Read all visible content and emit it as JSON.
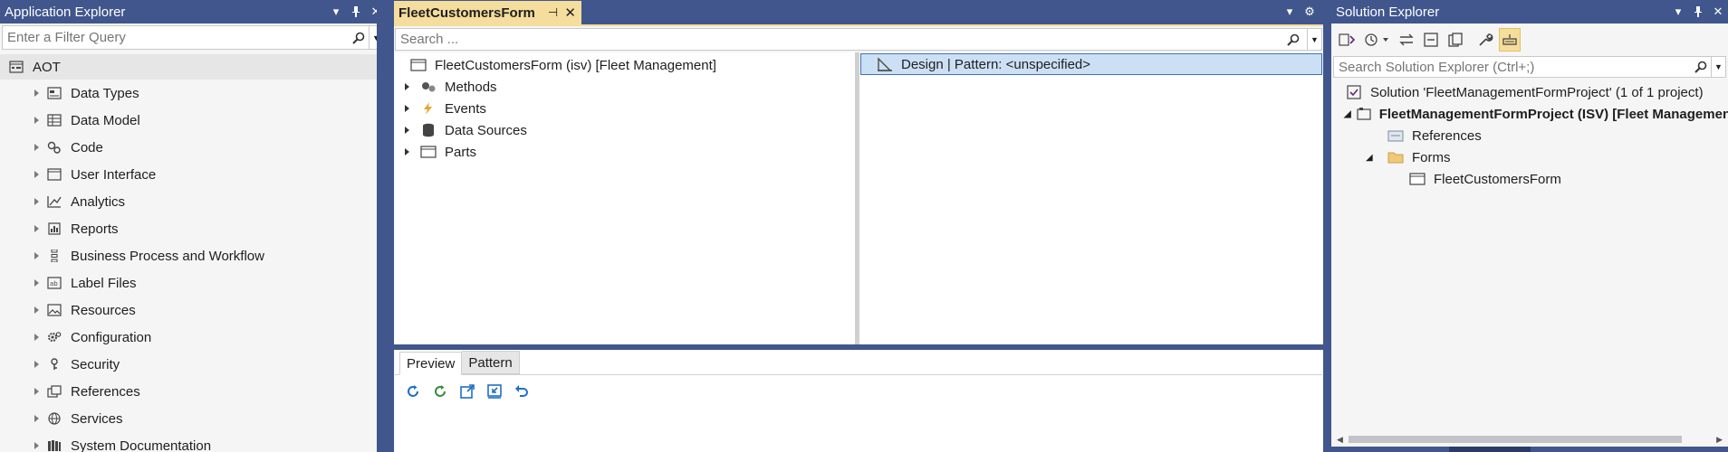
{
  "app_explorer": {
    "title": "Application Explorer",
    "filter_placeholder": "Enter a Filter Query",
    "root": "AOT",
    "items": [
      {
        "label": "Data Types",
        "icon": "data-types-icon"
      },
      {
        "label": "Data Model",
        "icon": "data-model-icon"
      },
      {
        "label": "Code",
        "icon": "code-icon"
      },
      {
        "label": "User Interface",
        "icon": "user-interface-icon"
      },
      {
        "label": "Analytics",
        "icon": "analytics-icon"
      },
      {
        "label": "Reports",
        "icon": "reports-icon"
      },
      {
        "label": "Business Process and Workflow",
        "icon": "workflow-icon"
      },
      {
        "label": "Label Files",
        "icon": "label-files-icon"
      },
      {
        "label": "Resources",
        "icon": "resources-icon"
      },
      {
        "label": "Configuration",
        "icon": "configuration-icon"
      },
      {
        "label": "Security",
        "icon": "security-icon"
      },
      {
        "label": "References",
        "icon": "references-icon"
      },
      {
        "label": "Services",
        "icon": "services-icon"
      },
      {
        "label": "System Documentation",
        "icon": "system-documentation-icon"
      }
    ]
  },
  "document": {
    "tab_title": "FleetCustomersForm",
    "search_placeholder": "Search ...",
    "form_root": "FleetCustomersForm (isv) [Fleet Management]",
    "form_nodes": [
      {
        "label": "Methods",
        "icon": "methods-icon"
      },
      {
        "label": "Events",
        "icon": "events-icon"
      },
      {
        "label": "Data Sources",
        "icon": "data-sources-icon"
      },
      {
        "label": "Parts",
        "icon": "parts-icon"
      }
    ],
    "design_row": "Design | Pattern: <unspecified>",
    "preview_tabs": [
      "Preview",
      "Pattern"
    ]
  },
  "solution_explorer": {
    "title": "Solution Explorer",
    "search_placeholder": "Search Solution Explorer (Ctrl+;)",
    "solution": "Solution 'FleetManagementFormProject' (1 of 1 project)",
    "project": "FleetManagementFormProject (ISV) [Fleet Management]",
    "references": "References",
    "forms": "Forms",
    "form_item": "FleetCustomersForm"
  },
  "colors": {
    "chrome": "#40568d",
    "active_tab": "#f4dd9d",
    "selection": "#cce0f5",
    "panel": "#f5f5f5"
  }
}
